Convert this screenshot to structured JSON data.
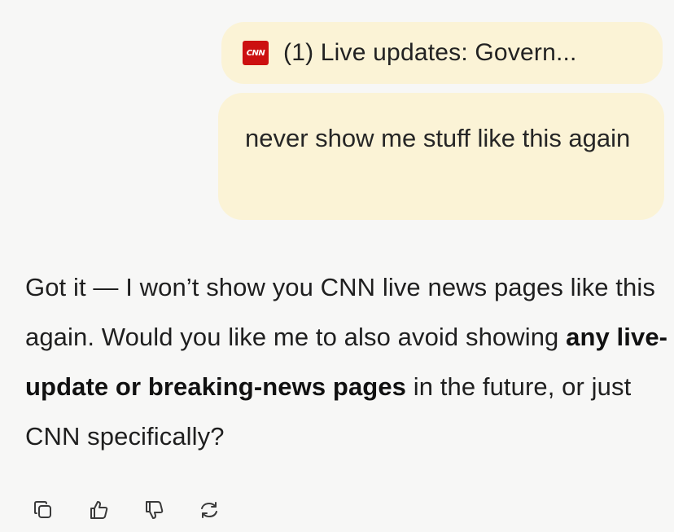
{
  "attachment": {
    "icon": "cnn-logo-icon",
    "logo_text": "CNN",
    "title": "(1) Live updates: Govern..."
  },
  "user_message": {
    "text": "never show me stuff like this again"
  },
  "assistant_message": {
    "part1": "Got it — I won’t show you CNN live news pages like this again. Would you like me to also avoid showing ",
    "bold": "any live-update or breaking-news pages",
    "part2": " in the future, or just CNN specifically?"
  },
  "actions": [
    {
      "name": "copy",
      "icon": "copy-icon"
    },
    {
      "name": "good-response",
      "icon": "thumbs-up-icon"
    },
    {
      "name": "bad-response",
      "icon": "thumbs-down-icon"
    },
    {
      "name": "regenerate",
      "icon": "regenerate-icon"
    }
  ],
  "colors": {
    "background": "#f7f7f6",
    "user_bubble": "#fbf3d6",
    "cnn_red": "#cc1010"
  }
}
